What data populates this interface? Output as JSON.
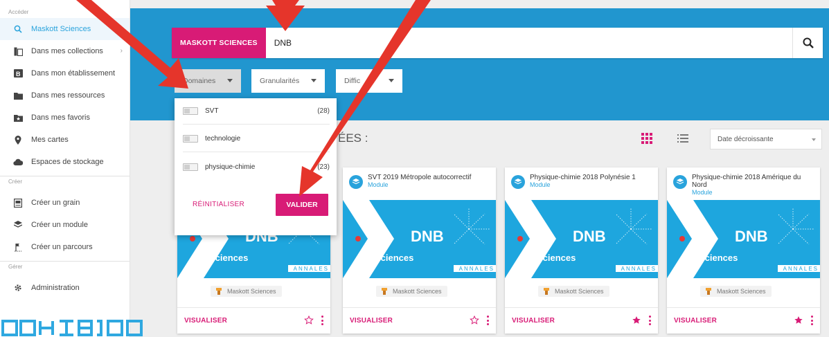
{
  "sidebar": {
    "sections": [
      {
        "title": "Accéder"
      },
      {
        "title": "Créer"
      },
      {
        "title": "Gérer"
      }
    ],
    "access_items": [
      {
        "label": "Maskott Sciences",
        "icon": "search-icon"
      },
      {
        "label": "Dans mes collections",
        "icon": "collections-icon"
      },
      {
        "label": "Dans mon établissement",
        "icon": "school-icon"
      },
      {
        "label": "Dans mes ressources",
        "icon": "folder-icon"
      },
      {
        "label": "Dans mes favoris",
        "icon": "star-folder-icon"
      },
      {
        "label": "Mes cartes",
        "icon": "map-pin-icon"
      },
      {
        "label": "Espaces de stockage",
        "icon": "cloud-icon"
      }
    ],
    "create_items": [
      {
        "label": "Créer un grain",
        "icon": "grain-icon"
      },
      {
        "label": "Créer un module",
        "icon": "module-icon"
      },
      {
        "label": "Créer un parcours",
        "icon": "path-icon"
      }
    ],
    "manage_items": [
      {
        "label": "Administration",
        "icon": "gear-icon"
      }
    ]
  },
  "search": {
    "tag": "MASKOTT SCIENCES",
    "value": "DNB"
  },
  "filters": {
    "domaines": "Domaines",
    "granularites": "Granularités",
    "difficulte": "Diffic"
  },
  "dropdown": {
    "items": [
      {
        "label": "SVT",
        "count": "(28)"
      },
      {
        "label": "technologie",
        "count": ""
      },
      {
        "label": "physique-chimie",
        "count": "(23)"
      }
    ],
    "reset": "RÉINITIALISER",
    "validate": "VALIDER"
  },
  "results": {
    "heading": "ÉES :",
    "sort": "Date décroissante"
  },
  "cards": [
    {
      "title": "",
      "type": "",
      "img_title": "DNB",
      "img_subtitle": "Sciences",
      "img_badge": "ANNALES",
      "source": "Maskott Sciences",
      "action": "VISUALISER",
      "favorite": false
    },
    {
      "title": "SVT 2019 Métropole autocorrectif",
      "type": "Module",
      "img_title": "DNB",
      "img_subtitle": "Sciences",
      "img_badge": "ANNALES",
      "source": "Maskott Sciences",
      "action": "VISUALISER",
      "favorite": false
    },
    {
      "title": "Physique-chimie 2018 Polynésie 1",
      "type": "Module",
      "img_title": "DNB",
      "img_subtitle": "Sciences",
      "img_badge": "ANNALES",
      "source": "Maskott Sciences",
      "action": "VISUALISER",
      "favorite": true
    },
    {
      "title": "Physique-chimie 2018 Amérique du Nord",
      "type": "Module",
      "img_title": "DNB",
      "img_subtitle": "Sciences",
      "img_badge": "ANNALES",
      "source": "Maskott Sciences",
      "action": "VISUALISER",
      "favorite": true
    }
  ],
  "colors": {
    "accent": "#d81b76",
    "banner": "#2196cf",
    "link": "#29a3dc",
    "arrow": "#e5352b"
  }
}
